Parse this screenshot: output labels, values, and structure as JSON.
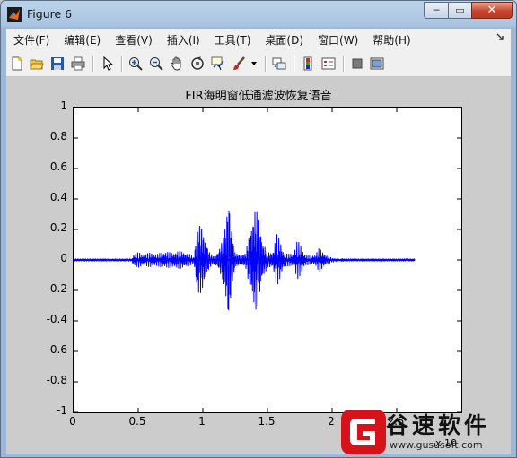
{
  "window": {
    "title": "Figure 6",
    "controls": {
      "minimize": "─",
      "maximize": "▭",
      "close": "✕"
    }
  },
  "menubar": {
    "items": [
      {
        "label": "文件(F)"
      },
      {
        "label": "编辑(E)"
      },
      {
        "label": "查看(V)"
      },
      {
        "label": "插入(I)"
      },
      {
        "label": "工具(T)"
      },
      {
        "label": "桌面(D)"
      },
      {
        "label": "窗口(W)"
      },
      {
        "label": "帮助(H)"
      }
    ],
    "overflow_icon": "arrow-icon"
  },
  "toolbar": {
    "icons": [
      "new-figure-icon",
      "open-file-icon",
      "save-icon",
      "print-icon",
      "edit-plot-arrow-icon",
      "zoom-in-icon",
      "zoom-out-icon",
      "pan-hand-icon",
      "rotate-3d-icon",
      "data-cursor-icon",
      "brush-icon",
      "brush-dropdown-icon",
      "link-plot-icon",
      "colorbar-icon",
      "legend-icon",
      "hide-plot-tools-icon",
      "show-plot-tools-icon"
    ]
  },
  "chart_data": {
    "type": "line",
    "title": "FIR海明窗低通滤波恢复语音",
    "xlabel": "",
    "ylabel": "",
    "x_scale_label": "x 10",
    "xlim": [
      0,
      3
    ],
    "ylim": [
      -1,
      1
    ],
    "xticks": [
      "0",
      "0.5",
      "1",
      "1.5",
      "2",
      "2.5"
    ],
    "yticks": [
      "1",
      "0.8",
      "0.6",
      "0.4",
      "0.2",
      "0",
      "-0.2",
      "-0.4",
      "-0.6",
      "-0.8",
      "-1"
    ],
    "series": [
      {
        "color": "#0000ff",
        "envelope": [
          [
            0.0,
            0.005
          ],
          [
            0.45,
            0.005
          ],
          [
            0.46,
            0.04
          ],
          [
            0.5,
            0.05
          ],
          [
            0.55,
            0.04
          ],
          [
            0.6,
            0.05
          ],
          [
            0.65,
            0.04
          ],
          [
            0.7,
            0.06
          ],
          [
            0.75,
            0.05
          ],
          [
            0.8,
            0.06
          ],
          [
            0.85,
            0.06
          ],
          [
            0.9,
            0.04
          ],
          [
            0.93,
            0.02
          ],
          [
            0.95,
            0.2
          ],
          [
            0.97,
            0.25
          ],
          [
            1.0,
            0.22
          ],
          [
            1.02,
            0.15
          ],
          [
            1.05,
            0.06
          ],
          [
            1.08,
            0.03
          ],
          [
            1.12,
            0.06
          ],
          [
            1.15,
            0.15
          ],
          [
            1.18,
            0.3
          ],
          [
            1.2,
            0.48
          ],
          [
            1.22,
            0.25
          ],
          [
            1.25,
            0.05
          ],
          [
            1.3,
            0.04
          ],
          [
            1.33,
            0.05
          ],
          [
            1.36,
            0.2
          ],
          [
            1.4,
            0.38
          ],
          [
            1.43,
            0.32
          ],
          [
            1.46,
            0.15
          ],
          [
            1.5,
            0.05
          ],
          [
            1.54,
            0.06
          ],
          [
            1.57,
            0.18
          ],
          [
            1.6,
            0.13
          ],
          [
            1.63,
            0.05
          ],
          [
            1.66,
            0.04
          ],
          [
            1.7,
            0.05
          ],
          [
            1.73,
            0.13
          ],
          [
            1.76,
            0.1
          ],
          [
            1.79,
            0.04
          ],
          [
            1.83,
            0.03
          ],
          [
            1.87,
            0.04
          ],
          [
            1.9,
            0.08
          ],
          [
            1.93,
            0.06
          ],
          [
            1.96,
            0.03
          ],
          [
            2.0,
            0.015
          ],
          [
            2.05,
            0.008
          ],
          [
            2.1,
            0.005
          ],
          [
            2.64,
            0.005
          ]
        ]
      }
    ]
  },
  "watermark": {
    "brand": "谷速软件",
    "url": "www.gususoft.com"
  }
}
